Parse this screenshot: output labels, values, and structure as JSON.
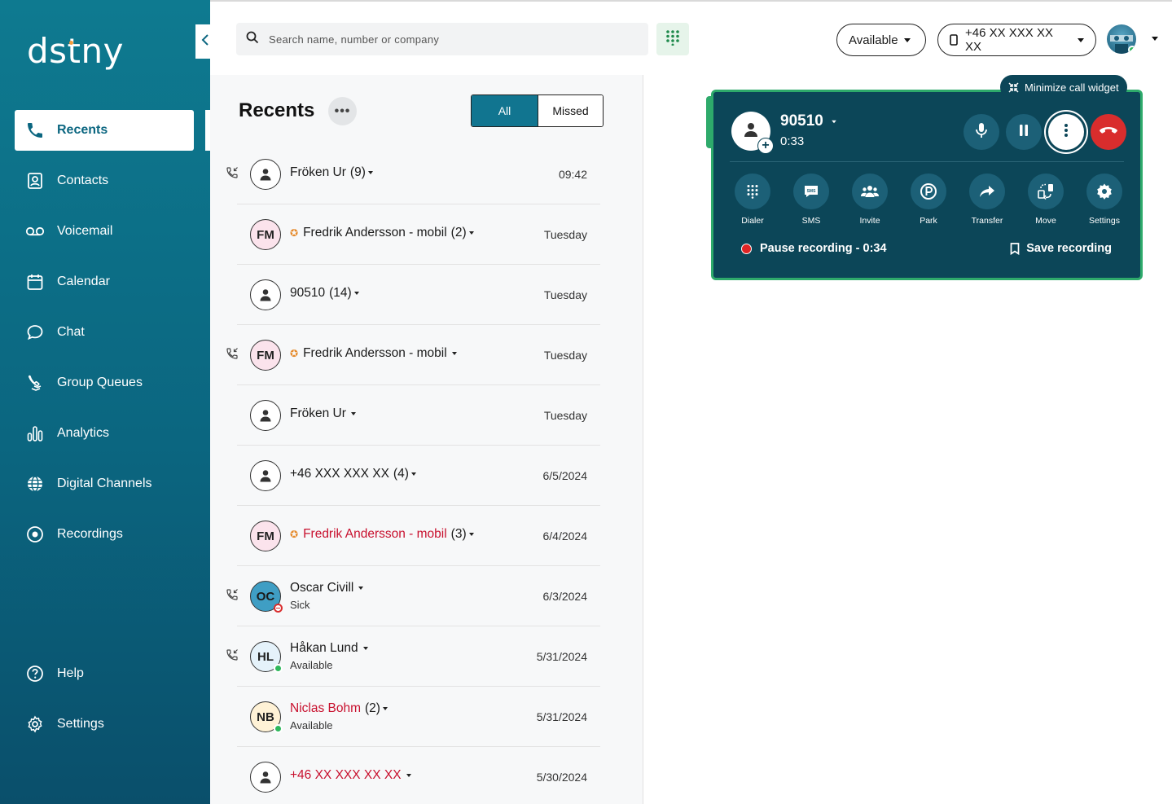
{
  "app": {
    "logo_text": "dstny"
  },
  "sidebar": {
    "items": [
      {
        "label": "Recents"
      },
      {
        "label": "Contacts"
      },
      {
        "label": "Voicemail"
      },
      {
        "label": "Calendar"
      },
      {
        "label": "Chat"
      },
      {
        "label": "Group Queues"
      },
      {
        "label": "Analytics"
      },
      {
        "label": "Digital Channels"
      },
      {
        "label": "Recordings"
      },
      {
        "label": "Help"
      },
      {
        "label": "Settings"
      }
    ]
  },
  "topbar": {
    "search_placeholder": "Search name, number or company",
    "status_label": "Available",
    "phone_label": "+46 XX XXX XX XX"
  },
  "recents": {
    "title": "Recents",
    "filters": {
      "all": "All",
      "missed": "Missed"
    },
    "rows": [
      {
        "avatar": "",
        "name": "Fröken Ur",
        "name_red": false,
        "count": "(9)",
        "sub": "",
        "time": "09:42",
        "star": false,
        "call_icon": true
      },
      {
        "avatar": "FM",
        "name": "Fredrik Andersson - mobil",
        "name_red": false,
        "count": "(2)",
        "sub": "",
        "time": "Tuesday",
        "star": true,
        "call_icon": false
      },
      {
        "avatar": "",
        "name": "90510",
        "name_red": false,
        "count": "(14)",
        "sub": "",
        "time": "Tuesday",
        "star": false,
        "call_icon": false
      },
      {
        "avatar": "FM",
        "name": "Fredrik Andersson - mobil",
        "name_red": false,
        "count": "",
        "sub": "",
        "time": "Tuesday",
        "star": true,
        "call_icon": true
      },
      {
        "avatar": "",
        "name": "Fröken Ur",
        "name_red": false,
        "count": "",
        "sub": "",
        "time": "Tuesday",
        "star": false,
        "call_icon": false
      },
      {
        "avatar": "",
        "name": "+46 XXX XXX XX",
        "name_red": false,
        "count": "(4)",
        "sub": "",
        "time": "6/5/2024",
        "star": false,
        "call_icon": false
      },
      {
        "avatar": "FM",
        "name": "Fredrik Andersson - mobil",
        "name_red": true,
        "count": "(3)",
        "sub": "",
        "time": "6/4/2024",
        "star": true,
        "call_icon": false
      },
      {
        "avatar": "OC",
        "name": "Oscar Civill",
        "name_red": false,
        "count": "",
        "sub": "Sick",
        "time": "6/3/2024",
        "star": false,
        "call_icon": true
      },
      {
        "avatar": "HL",
        "name": "Håkan Lund",
        "name_red": false,
        "count": "",
        "sub": "Available",
        "time": "5/31/2024",
        "star": false,
        "call_icon": true
      },
      {
        "avatar": "NB",
        "name": "Niclas Bohm",
        "name_red": true,
        "count": "(2)",
        "sub": "Available",
        "time": "5/31/2024",
        "star": false,
        "call_icon": false
      },
      {
        "avatar": "",
        "name": "+46 XX XXX XX XX",
        "name_red": true,
        "count": "",
        "sub": "",
        "time": "5/30/2024",
        "star": false,
        "call_icon": false
      }
    ]
  },
  "call_widget": {
    "minimize_label": "Minimize call widget",
    "caller": "90510",
    "timer": "0:33",
    "actions": [
      {
        "label": "Dialer"
      },
      {
        "label": "SMS"
      },
      {
        "label": "Invite"
      },
      {
        "label": "Park"
      },
      {
        "label": "Transfer"
      },
      {
        "label": "Move"
      },
      {
        "label": "Settings"
      }
    ],
    "pause_recording": "Pause recording - 0:34",
    "save_recording": "Save recording"
  },
  "colors": {
    "sidebar": "#0b6680",
    "accent": "#117590",
    "widget_bg": "#0c4658",
    "widget_border": "#2eaa6b",
    "hangup": "#d92d2d",
    "missed_red": "#c8102e",
    "available_green": "#2eb85c",
    "sick_red": "#d92d2d"
  }
}
